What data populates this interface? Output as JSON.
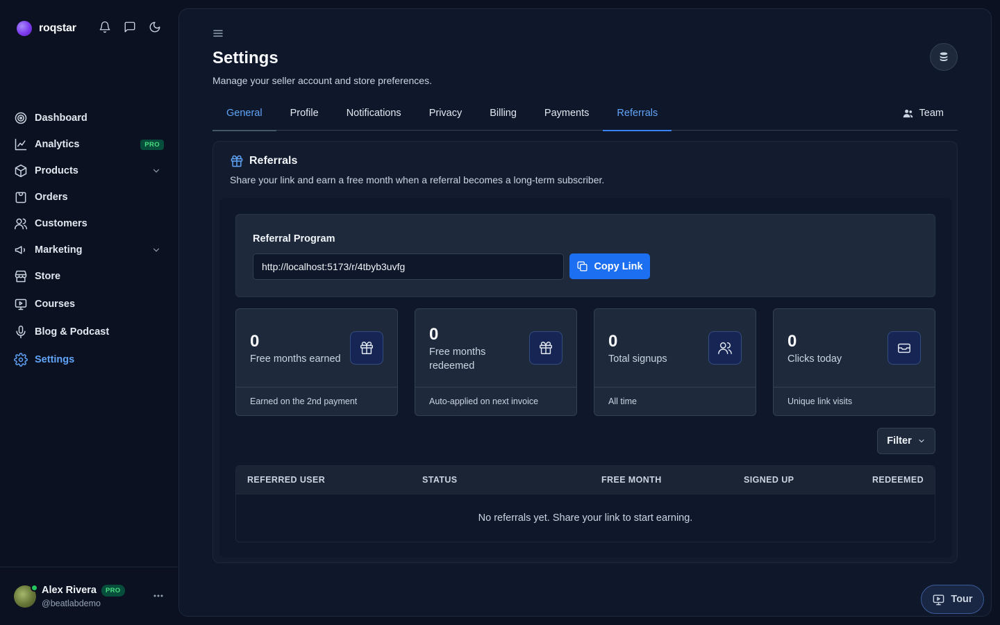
{
  "brand": {
    "name": "roqstar"
  },
  "sidebar": {
    "items": [
      {
        "label": "Dashboard",
        "icon": "dashboard-icon"
      },
      {
        "label": "Analytics",
        "icon": "analytics-icon",
        "badge": "PRO"
      },
      {
        "label": "Products",
        "icon": "box-icon",
        "expandable": true
      },
      {
        "label": "Orders",
        "icon": "orders-icon"
      },
      {
        "label": "Customers",
        "icon": "users-icon"
      },
      {
        "label": "Marketing",
        "icon": "megaphone-icon",
        "expandable": true
      },
      {
        "label": "Store",
        "icon": "store-icon"
      },
      {
        "label": "Courses",
        "icon": "courses-icon"
      },
      {
        "label": "Blog & Podcast",
        "icon": "mic-icon"
      },
      {
        "label": "Settings",
        "icon": "gear-icon",
        "active": true
      }
    ]
  },
  "user": {
    "name": "Alex Rivera",
    "badge": "PRO",
    "handle": "@beatlabdemo"
  },
  "page": {
    "title": "Settings",
    "subtitle": "Manage your seller account and store preferences."
  },
  "tabs": {
    "items": [
      "General",
      "Profile",
      "Notifications",
      "Privacy",
      "Billing",
      "Payments",
      "Referrals"
    ],
    "active": "Referrals",
    "team": "Team"
  },
  "referrals": {
    "title": "Referrals",
    "subtitle": "Share your link and earn a free month when a referral becomes a long-term subscriber.",
    "program_title": "Referral Program",
    "link": "http://localhost:5173/r/4tbyb3uvfg",
    "copy_label": "Copy Link"
  },
  "stats": [
    {
      "value": "0",
      "label": "Free months earned",
      "foot": "Earned on the 2nd payment",
      "icon": "gift-icon"
    },
    {
      "value": "0",
      "label": "Free months redeemed",
      "foot": "Auto-applied on next invoice",
      "icon": "gift-icon"
    },
    {
      "value": "0",
      "label": "Total signups",
      "foot": "All time",
      "icon": "users-icon"
    },
    {
      "value": "0",
      "label": "Clicks today",
      "foot": "Unique link visits",
      "icon": "inbox-icon"
    }
  ],
  "filter": {
    "label": "Filter"
  },
  "table": {
    "columns": [
      "REFERRED USER",
      "STATUS",
      "FREE MONTH",
      "SIGNED UP",
      "REDEEMED"
    ],
    "empty": "No referrals yet. Share your link to start earning."
  },
  "tour": {
    "label": "Tour"
  },
  "colors": {
    "accent": "#3b82f6",
    "accent_text": "#60a5fa",
    "pro_badge": "#4ade80",
    "button": "#1d6ff2"
  }
}
